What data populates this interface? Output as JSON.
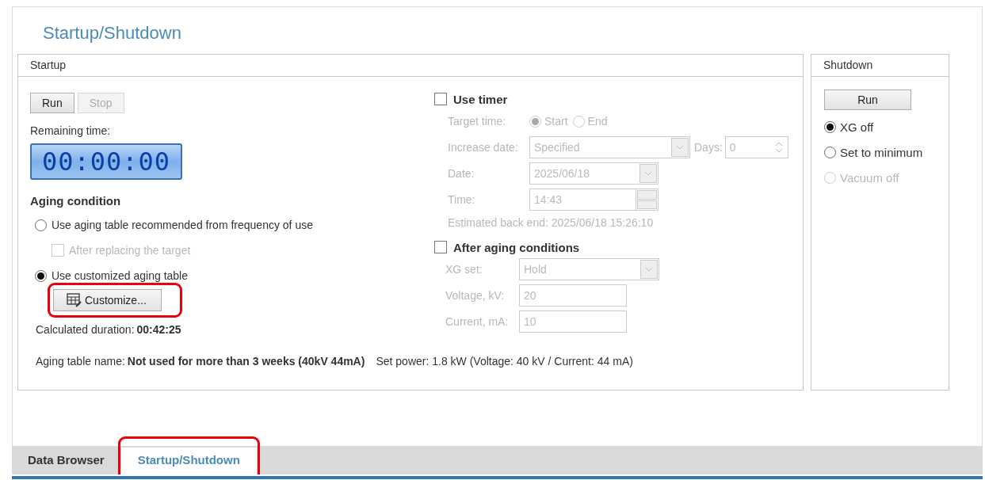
{
  "title": "Startup/Shutdown",
  "startup": {
    "title": "Startup",
    "run_button": {
      "label": "Run",
      "disabled": false
    },
    "stop_button": {
      "label": "Stop",
      "disabled": true
    },
    "remaining_label": "Remaining time:",
    "timer_display": "00:00:00",
    "aging_title": "Aging condition",
    "aging_options": [
      {
        "kind": "radio",
        "label": "Use aging table recommended from frequency of use",
        "selected": false,
        "disabled": false
      },
      {
        "kind": "checkbox",
        "label": "After replacing the target",
        "checked": false,
        "disabled": true
      },
      {
        "kind": "radio",
        "label": "Use customized aging table",
        "selected": true,
        "disabled": false
      }
    ],
    "customize_button": {
      "label": "Customize...",
      "highlighted": true
    },
    "duration_label": "Calculated duration:",
    "duration_value": "00:42:25",
    "table_name_label": "Aging table name:",
    "table_name_value": "Not used for more than 3 weeks (40kV 44mA)",
    "use_timer": {
      "label": "Use timer",
      "checked": false
    },
    "target_time": {
      "label": "Target time:",
      "options": [
        {
          "label": "Start",
          "selected": true
        },
        {
          "label": "End",
          "selected": false
        }
      ]
    },
    "increase_date": {
      "label": "Increase date:",
      "value": "Specified"
    },
    "days": {
      "label": "Days:",
      "value": "0"
    },
    "date": {
      "label": "Date:",
      "value": "2025/06/18"
    },
    "time": {
      "label": "Time:",
      "value": "14:43"
    },
    "estimated": "Estimated back end: 2025/06/18 15:26:10",
    "after_aging": {
      "label": "After aging conditions",
      "checked": false
    },
    "xg_set": {
      "label": "XG set:",
      "value": "Hold"
    },
    "voltage": {
      "label": "Voltage, kV:",
      "value": "20"
    },
    "current": {
      "label": "Current, mA:",
      "value": "10"
    },
    "set_power": "Set power: 1.8 kW (Voltage: 40 kV / Current: 44 mA)"
  },
  "shutdown": {
    "title": "Shutdown",
    "run_button": {
      "label": "Run"
    },
    "options": [
      {
        "label": "XG off",
        "selected": true,
        "disabled": false
      },
      {
        "label": "Set to minimum",
        "selected": false,
        "disabled": false
      },
      {
        "label": "Vacuum off",
        "selected": false,
        "disabled": true
      }
    ]
  },
  "tabs": [
    {
      "label": "Data Browser",
      "selected": false,
      "highlighted": false
    },
    {
      "label": "Startup/Shutdown",
      "selected": true,
      "highlighted": true
    }
  ]
}
